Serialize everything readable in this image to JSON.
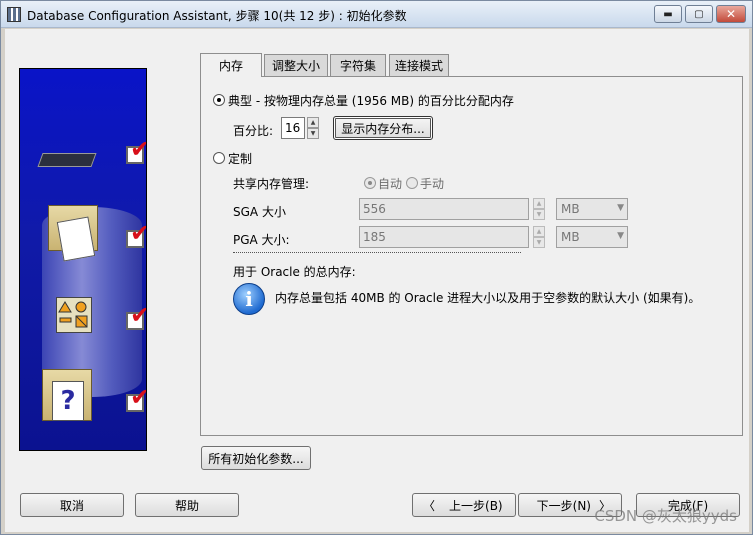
{
  "window": {
    "title": "Database Configuration Assistant, 步骤 10(共 12 步) : 初始化参数",
    "minimize": "▬",
    "maximize": "▢",
    "close": "✕"
  },
  "tabs": [
    {
      "label": "内存",
      "active": true
    },
    {
      "label": "调整大小",
      "active": false
    },
    {
      "label": "字符集",
      "active": false
    },
    {
      "label": "连接模式",
      "active": false
    }
  ],
  "typical": {
    "label": "典型 - 按物理内存总量 (1956 MB) 的百分比分配内存",
    "selected": true,
    "percent_label": "百分比:",
    "percent_value": "16",
    "show_dist_button": "显示内存分布..."
  },
  "custom": {
    "label": "定制",
    "selected": false,
    "shared_mem_label": "共享内存管理:",
    "auto_label": "自动",
    "manual_label": "手动",
    "auto_selected": true,
    "sga_label": "SGA 大小",
    "sga_value": "556",
    "sga_unit": "MB",
    "pga_label": "PGA 大小:",
    "pga_value": "185",
    "pga_unit": "MB"
  },
  "total_memory": {
    "label": "用于 Oracle 的总内存:",
    "info_text": "内存总量包括 40MB 的 Oracle 进程大小以及用于空参数的默认大小 (如果有)。",
    "info_icon_glyph": "i"
  },
  "all_params_button": "所有初始化参数...",
  "footer": {
    "cancel": "取消",
    "help": "帮助",
    "back": "上一步(B)",
    "next": "下一步(N)",
    "finish": "完成(F)",
    "back_arrow": "〈",
    "next_arrow": "〉"
  },
  "arrows": {
    "up": "▲",
    "down": "▼",
    "dropdown": "▼"
  },
  "watermark": "CSDN @灰太狼yyds",
  "colors": {
    "side_image_blue": "#0a14c8",
    "check_red": "#d8101a"
  }
}
